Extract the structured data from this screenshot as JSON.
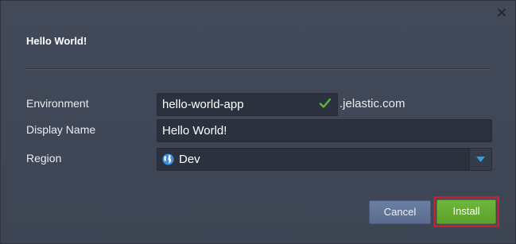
{
  "dialog": {
    "title": "Hello World!",
    "close_icon": "close-icon"
  },
  "form": {
    "environment": {
      "label": "Environment",
      "value": "hello-world-app",
      "status_icon": "checkmark-icon",
      "status_color": "#5fb53a",
      "suffix": ".jelastic.com"
    },
    "display_name": {
      "label": "Display Name",
      "value": "Hello World!"
    },
    "region": {
      "label": "Region",
      "value": "Dev",
      "icon": "globe-icon",
      "dropdown_icon": "chevron-down-icon"
    }
  },
  "buttons": {
    "cancel_label": "Cancel",
    "install_label": "Install",
    "install_highlight_color": "#c8202a"
  }
}
